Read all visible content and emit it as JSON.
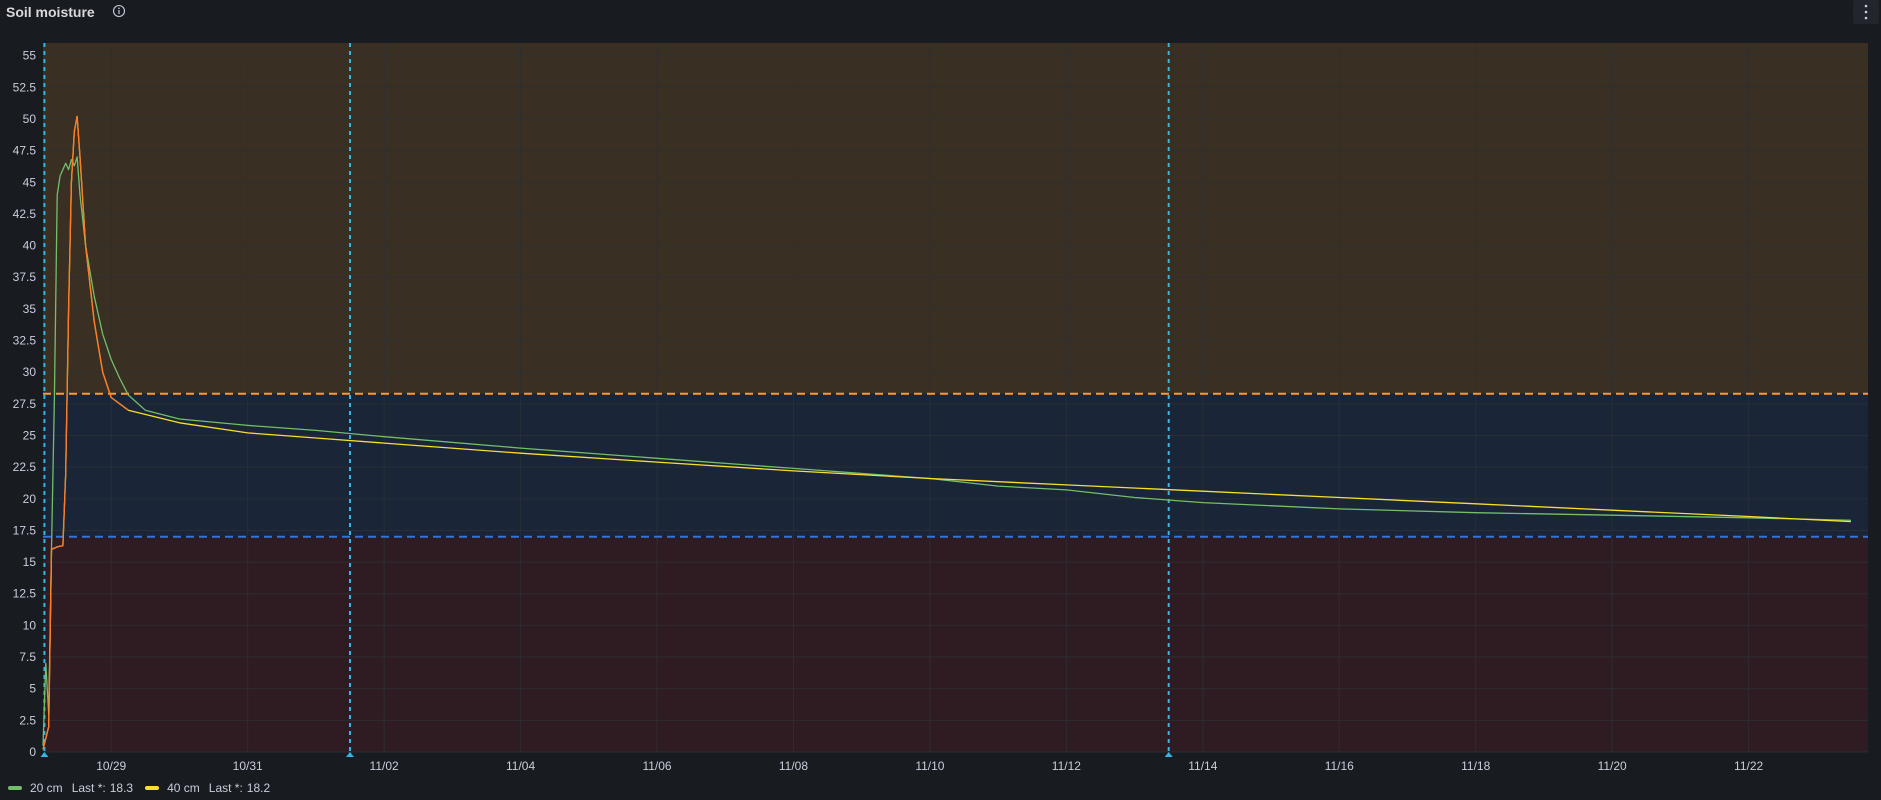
{
  "panel": {
    "title": "Soil moisture",
    "info_icon": "info-circle-icon",
    "menu_icon": "vertical-ellipsis-icon"
  },
  "colors": {
    "background": "#181b1f",
    "grid": "#2c3036",
    "band_high": "#3a2f23",
    "band_mid": "#1a2537",
    "band_low": "#2f1c23",
    "threshold_high": "#ff9830",
    "threshold_low": "#3274d9",
    "annotation": "#33b5e5",
    "series_20cm": "#73bf69",
    "series_40cm": "#fade2a",
    "series_40cm_peak": "#ff7828",
    "axis_text": "#ccccdc"
  },
  "legend": [
    {
      "name": "20 cm",
      "last_label": "Last *:",
      "last_value": "18.3",
      "color": "#73bf69"
    },
    {
      "name": "40 cm",
      "last_label": "Last *:",
      "last_value": "18.2",
      "color": "#fade2a"
    }
  ],
  "chart_data": {
    "type": "line",
    "x_range": [
      "2023-10-28",
      "2023-11-23T18:00"
    ],
    "x_ticks": [
      "10/29",
      "10/31",
      "11/02",
      "11/04",
      "11/06",
      "11/08",
      "11/10",
      "11/12",
      "11/14",
      "11/16",
      "11/18",
      "11/20",
      "11/22"
    ],
    "y_range": [
      0,
      56
    ],
    "y_ticks": [
      "0",
      "2.5",
      "5",
      "7.5",
      "10",
      "12.5",
      "15",
      "17.5",
      "20",
      "22.5",
      "25",
      "27.5",
      "30",
      "32.5",
      "35",
      "37.5",
      "40",
      "42.5",
      "45",
      "47.5",
      "50",
      "52.5",
      "55"
    ],
    "grid": true,
    "legend_position": "bottom-left",
    "threshold_bands": [
      {
        "from": 28.3,
        "to": 56,
        "color": "#3a2f23"
      },
      {
        "from": 17,
        "to": 28.3,
        "color": "#1a2537"
      },
      {
        "from": 0,
        "to": 17,
        "color": "#2f1c23"
      }
    ],
    "threshold_lines": [
      {
        "value": 28.3,
        "color": "#ff9830"
      },
      {
        "value": 17,
        "color": "#3274d9"
      }
    ],
    "annotations": [
      "2023-10-28T00:30",
      "2023-11-01T12:00",
      "2023-11-13T12:00"
    ],
    "series": [
      {
        "name": "20 cm",
        "color": "#73bf69",
        "points": [
          [
            "2023-10-28T00:00",
            0.5
          ],
          [
            "2023-10-28T01:00",
            7
          ],
          [
            "2023-10-28T02:00",
            3
          ],
          [
            "2023-10-28T03:00",
            16
          ],
          [
            "2023-10-28T04:00",
            28
          ],
          [
            "2023-10-28T05:00",
            44
          ],
          [
            "2023-10-28T06:00",
            45.5
          ],
          [
            "2023-10-28T08:00",
            46.5
          ],
          [
            "2023-10-28T09:00",
            46
          ],
          [
            "2023-10-28T10:00",
            46.8
          ],
          [
            "2023-10-28T11:00",
            46.3
          ],
          [
            "2023-10-28T12:00",
            47
          ],
          [
            "2023-10-28T13:00",
            44
          ],
          [
            "2023-10-28T15:00",
            40
          ],
          [
            "2023-10-28T18:00",
            36
          ],
          [
            "2023-10-28T21:00",
            33
          ],
          [
            "2023-10-29T00:00",
            31
          ],
          [
            "2023-10-29T03:00",
            29.5
          ],
          [
            "2023-10-29T06:00",
            28.2
          ],
          [
            "2023-10-29T12:00",
            27
          ],
          [
            "2023-10-30T00:00",
            26.3
          ],
          [
            "2023-10-31T00:00",
            25.8
          ],
          [
            "2023-11-01T00:00",
            25.4
          ],
          [
            "2023-11-02T00:00",
            24.9
          ],
          [
            "2023-11-04T00:00",
            24
          ],
          [
            "2023-11-06T00:00",
            23.2
          ],
          [
            "2023-11-08T00:00",
            22.4
          ],
          [
            "2023-11-10T00:00",
            21.6
          ],
          [
            "2023-11-11T00:00",
            21
          ],
          [
            "2023-11-12T00:00",
            20.7
          ],
          [
            "2023-11-13T00:00",
            20.1
          ],
          [
            "2023-11-14T00:00",
            19.7
          ],
          [
            "2023-11-16T00:00",
            19.2
          ],
          [
            "2023-11-18T00:00",
            18.9
          ],
          [
            "2023-11-20T00:00",
            18.7
          ],
          [
            "2023-11-22T00:00",
            18.5
          ],
          [
            "2023-11-23T12:00",
            18.3
          ]
        ]
      },
      {
        "name": "40 cm",
        "color": "#fade2a",
        "points": [
          [
            "2023-10-28T00:00",
            0.2
          ],
          [
            "2023-10-28T02:00",
            2
          ],
          [
            "2023-10-28T03:00",
            16
          ],
          [
            "2023-10-28T05:00",
            16.2
          ],
          [
            "2023-10-28T07:00",
            16.3
          ],
          [
            "2023-10-28T08:00",
            22
          ],
          [
            "2023-10-28T09:00",
            35
          ],
          [
            "2023-10-28T10:00",
            45
          ],
          [
            "2023-10-28T11:00",
            49
          ],
          [
            "2023-10-28T12:00",
            50.2
          ],
          [
            "2023-10-28T13:00",
            47
          ],
          [
            "2023-10-28T15:00",
            40
          ],
          [
            "2023-10-28T18:00",
            34
          ],
          [
            "2023-10-28T21:00",
            30
          ],
          [
            "2023-10-29T00:00",
            28
          ],
          [
            "2023-10-29T06:00",
            27
          ],
          [
            "2023-10-30T00:00",
            26
          ],
          [
            "2023-10-31T00:00",
            25.2
          ],
          [
            "2023-11-01T00:00",
            24.8
          ],
          [
            "2023-11-02T00:00",
            24.4
          ],
          [
            "2023-11-04T00:00",
            23.6
          ],
          [
            "2023-11-06T00:00",
            22.9
          ],
          [
            "2023-11-08T00:00",
            22.2
          ],
          [
            "2023-11-10T00:00",
            21.6
          ],
          [
            "2023-11-12T00:00",
            21.1
          ],
          [
            "2023-11-14T00:00",
            20.6
          ],
          [
            "2023-11-16T00:00",
            20.1
          ],
          [
            "2023-11-18T00:00",
            19.6
          ],
          [
            "2023-11-20T00:00",
            19.1
          ],
          [
            "2023-11-22T00:00",
            18.6
          ],
          [
            "2023-11-23T12:00",
            18.2
          ]
        ]
      }
    ]
  }
}
